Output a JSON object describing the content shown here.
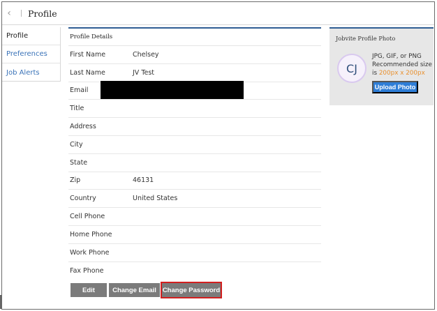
{
  "header": {
    "back_icon": "chevron-left-icon",
    "title": "Profile"
  },
  "sidebar": {
    "items": [
      {
        "label": "Profile",
        "active": true
      },
      {
        "label": "Preferences",
        "active": false
      },
      {
        "label": "Job Alerts",
        "active": false
      }
    ]
  },
  "details": {
    "title": "Profile Details",
    "fields": [
      {
        "label": "First Name",
        "value": "Chelsey"
      },
      {
        "label": "Last Name",
        "value": "JV Test"
      },
      {
        "label": "Email",
        "value": ""
      },
      {
        "label": "Title",
        "value": ""
      },
      {
        "label": "Address",
        "value": ""
      },
      {
        "label": "City",
        "value": ""
      },
      {
        "label": "State",
        "value": ""
      },
      {
        "label": "Zip",
        "value": "46131"
      },
      {
        "label": "Country",
        "value": "United States"
      },
      {
        "label": "Cell Phone",
        "value": ""
      },
      {
        "label": "Home Phone",
        "value": ""
      },
      {
        "label": "Work Phone",
        "value": ""
      },
      {
        "label": "Fax Phone",
        "value": ""
      }
    ]
  },
  "buttons": {
    "edit": "Edit",
    "change_email": "Change Email",
    "change_password": "Change Password"
  },
  "photo": {
    "title": "Jobvite Profile Photo",
    "initials": "CJ",
    "hint_prefix": "JPG, GIF, or PNG Recommended size is ",
    "hint_size": "200px x 200px",
    "upload_label": "Upload Photo"
  },
  "colors": {
    "accent": "#2f5d93",
    "link": "#3a73b8",
    "button": "#7b7b7b",
    "upload": "#2e7dd6",
    "highlight": "#d21f1f",
    "hint_size": "#e8902e"
  }
}
